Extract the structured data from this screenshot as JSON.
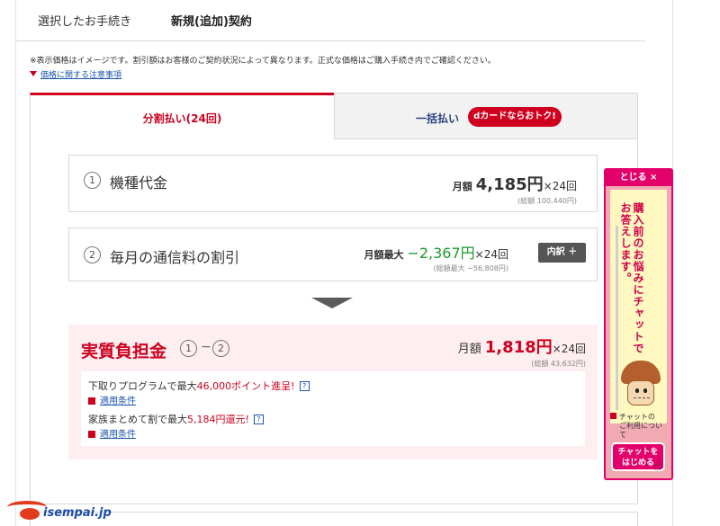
{
  "header": {
    "selected_procedure_label": "選択したお手続き",
    "selected_procedure_value": "新規(追加)契約"
  },
  "notice": {
    "text": "※表示価格はイメージです。割引額はお客様のご契約状況によって異なります。正式な価格はご購入手続き内でご確認ください。",
    "price_note_link": "価格に関する注意事項"
  },
  "tabs": [
    {
      "label": "分割払い(24回)",
      "active": true
    },
    {
      "label": "一括払い",
      "badge": "dカードならおトク!",
      "active": false
    }
  ],
  "device": {
    "number": "1",
    "title": "機種代金",
    "prefix": "月額",
    "amount": "4,185円",
    "times": "×24回",
    "total": "(総額 100,440円)"
  },
  "discount": {
    "number": "2",
    "title": "毎月の通信料の割引",
    "prefix": "月額最大",
    "amount": "−2,367円",
    "times": "×24回",
    "total": "(総額最大 −56,808円)",
    "detail_button": "内訳 ＋"
  },
  "real_cost": {
    "title": "実質負担金",
    "ref1": "1",
    "dash": "−",
    "ref2": "2",
    "prefix": "月額",
    "amount": "1,818円",
    "times": "×24回",
    "total": "(総額 43,632円)",
    "benefits": [
      {
        "text_before": "下取りプログラムで最大",
        "amount": "46,000ポイント進呈!",
        "help": "?",
        "cond": "適用条件"
      },
      {
        "text_before": "家族まとめて割で最大",
        "amount": "5,184円還元!",
        "help": "?",
        "cond": "適用条件"
      }
    ]
  },
  "chat_widget": {
    "close": "とじる ×",
    "vertical_text": "購入前のお悩みにチャットでお答えします。",
    "about_line1": "チャットの",
    "about_line2": "ご利用について",
    "start_line1": "チャットを",
    "start_line2": "はじめる"
  },
  "logo": {
    "text": "isempai.jp"
  },
  "colors": {
    "accent": "#d0001f",
    "discount_green": "#1a9a2a",
    "link": "#1a55b0",
    "chat_pink": "#e4006b"
  }
}
